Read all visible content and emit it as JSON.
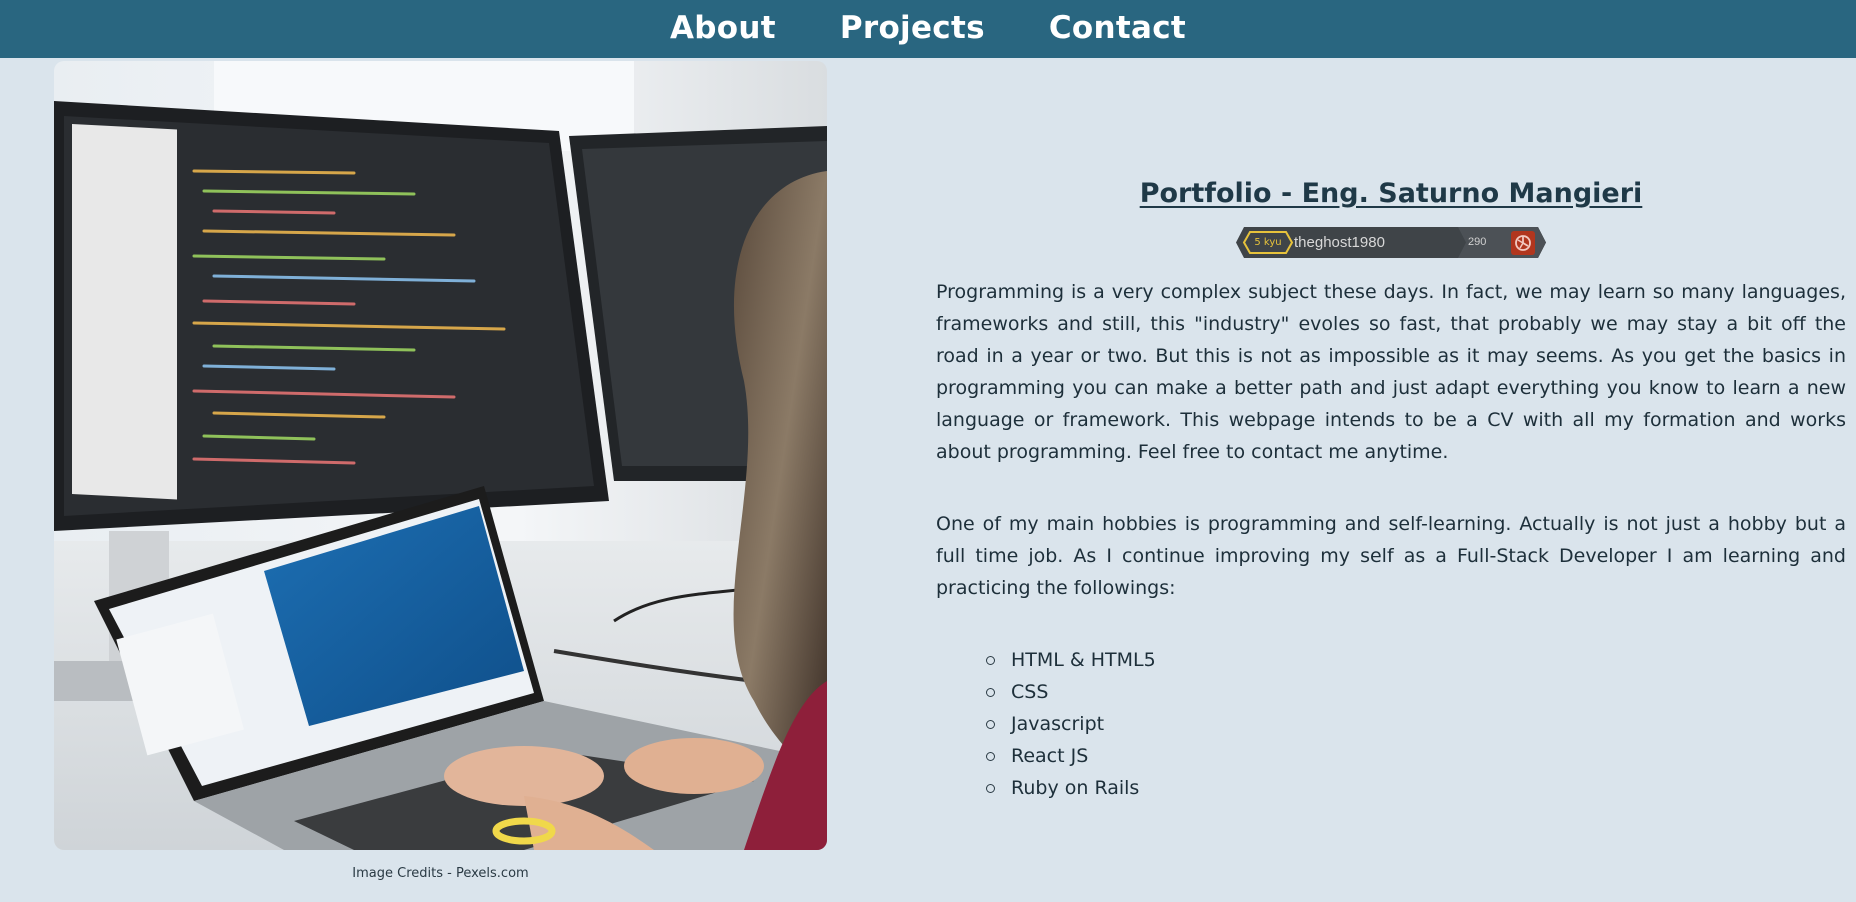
{
  "nav": {
    "items": [
      {
        "label": "About"
      },
      {
        "label": "Projects"
      },
      {
        "label": "Contact"
      }
    ]
  },
  "hero_image": {
    "alt": "Person coding on laptop and monitors",
    "credits": "Image Credits - Pexels.com"
  },
  "main": {
    "title": "Portfolio - Eng. Saturno Mangieri",
    "badge": {
      "rank": "5 kyu",
      "username": "theghost1980",
      "honor": "290",
      "icon": "codewars-logo-icon"
    },
    "intro": "Programming is a very complex subject these days. In fact, we may learn so many languages, frameworks and still, this \"industry\" evoles so fast, that probably we may stay a bit off the road in a year or two. But this is not as impossible as it may seems. As you get the basics in programming you can make a better path and just adapt everything you know to learn a new language or framework. This webpage intends to be a CV with all my formation and works about programming. Feel free to contact me anytime.",
    "hobbies": "One of my main hobbies is programming and self-learning. Actually is not just a hobby but a full time job. As I continue improving my self as a Full-Stack Developer I am learning and practicing the followings:",
    "skills": [
      "HTML & HTML5",
      "CSS",
      "Javascript",
      "React JS",
      "Ruby on Rails"
    ]
  },
  "colors": {
    "nav_bg": "#296680",
    "page_bg": "#dae4ec",
    "text": "#1d2f3a",
    "badge_bg": "#3f4448",
    "rank_yellow": "#e6c23b",
    "codewars_red": "#b1361e"
  }
}
